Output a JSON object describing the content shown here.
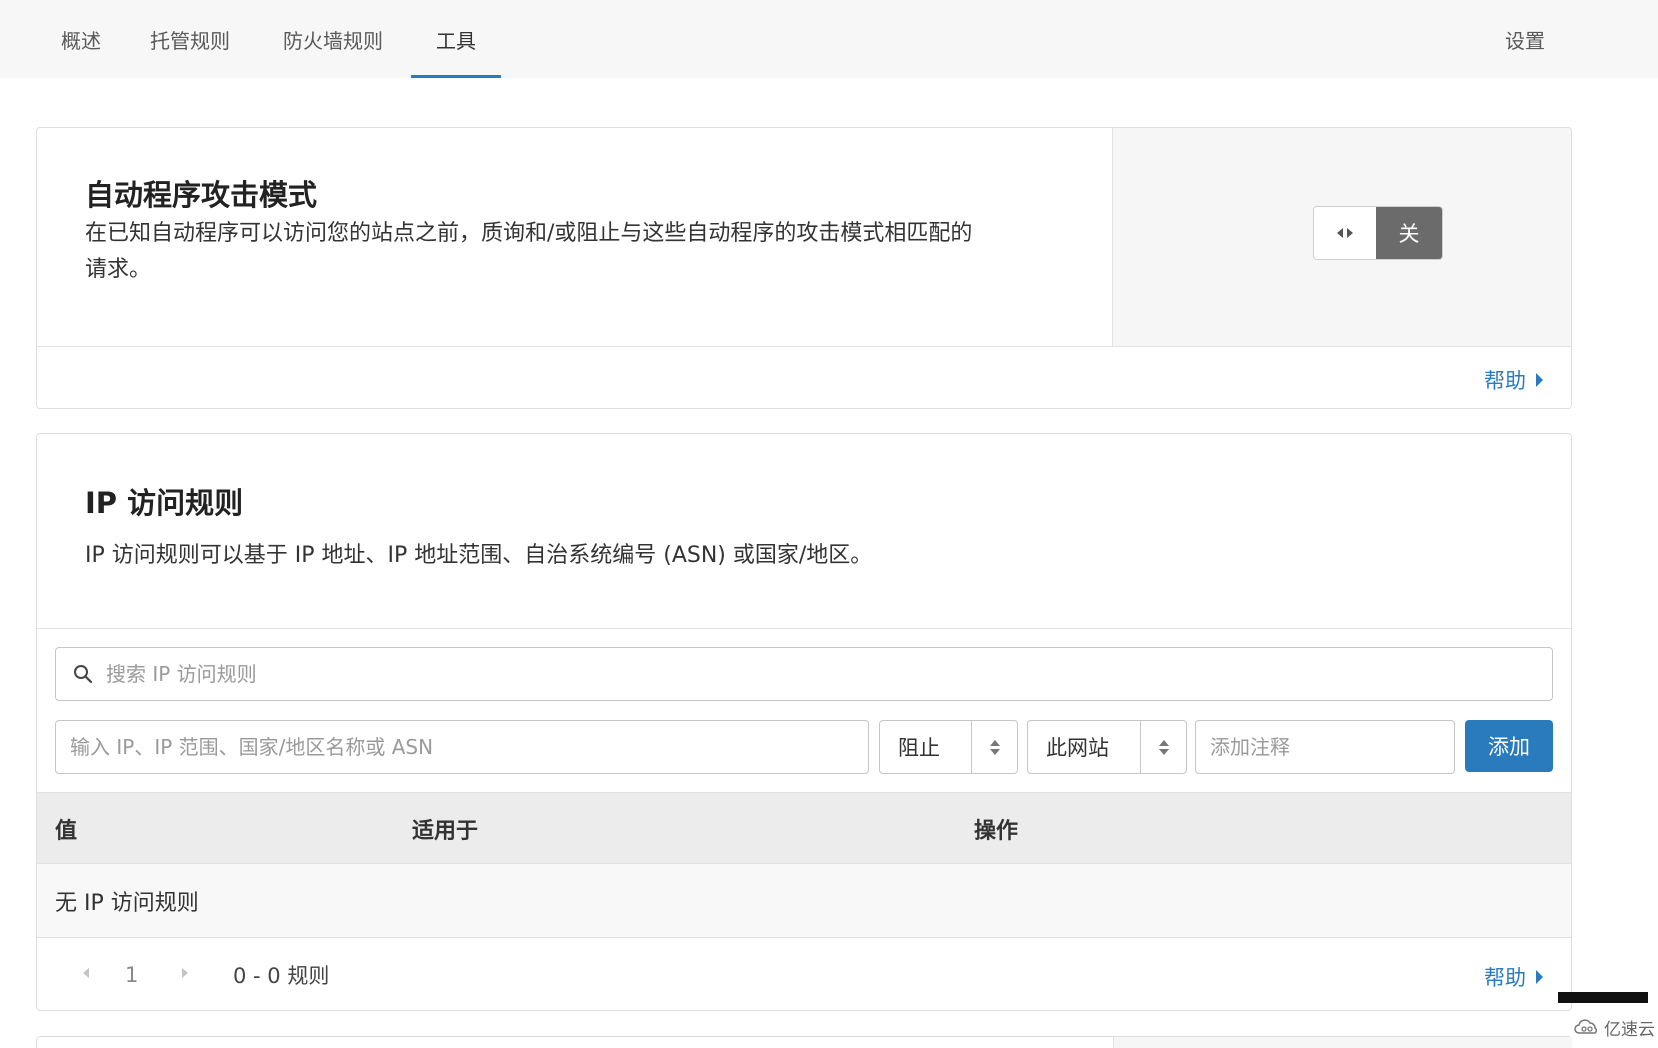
{
  "nav": {
    "tabs": [
      {
        "label": "概述"
      },
      {
        "label": "托管规则"
      },
      {
        "label": "防火墙规则"
      },
      {
        "label": "工具"
      }
    ],
    "active_tab": 3,
    "settings_label": "设置"
  },
  "bot_card": {
    "title": "自动程序攻击模式",
    "desc_line1": "在已知自动程序可以访问您的站点之前，质询和/或阻止与这些自动程序的攻击模式相匹配的",
    "desc_line2": "请求。",
    "toggle_state": "关",
    "toggle_on": false,
    "help_label": "帮助"
  },
  "ip_card": {
    "title": "IP 访问规则",
    "description": "IP 访问规则可以基于 IP 地址、IP 地址范围、自治系统编号 (ASN) 或国家/地区。",
    "search_placeholder": "搜索 IP 访问规则",
    "ip_input_placeholder": "输入 IP、IP 范围、国家/地区名称或 ASN",
    "action_select": "阻止",
    "scope_select": "此网站",
    "note_placeholder": "添加注释",
    "add_button": "添加",
    "table": {
      "columns": [
        "值",
        "适用于",
        "操作"
      ],
      "empty_text": "无 IP 访问规则"
    },
    "pager": {
      "page": "1",
      "range": "0 - 0 规则"
    },
    "help_label": "帮助"
  },
  "watermark": {
    "brand": "亿速云"
  },
  "colors": {
    "accent": "#2a7bbd",
    "toggle_off_bg": "#6b6b6b",
    "nav_bg": "#f7f7f7",
    "table_header_bg": "#ececec"
  }
}
